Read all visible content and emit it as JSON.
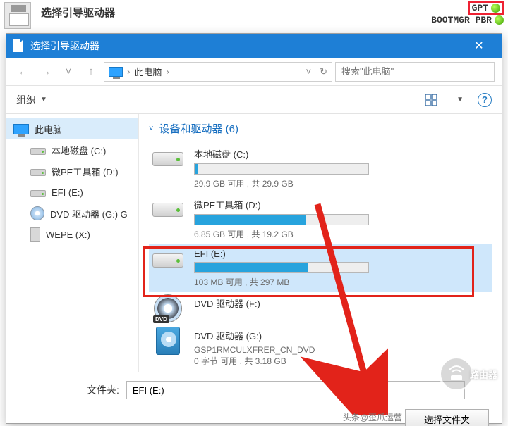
{
  "top": {
    "title": "选择引导驱动器",
    "flags": {
      "gpt": "GPT",
      "bootmgr": "BOOTMGR PBR"
    }
  },
  "dialog": {
    "title": "选择引导驱动器",
    "close_glyph": "✕"
  },
  "nav": {
    "back_glyph": "←",
    "fwd_glyph": "→",
    "up_glyph": "↑",
    "crumb_sep1": "›",
    "crumb_text": "此电脑",
    "crumb_sep2": "›",
    "refresh_glyph": "↻",
    "dd_glyph": "˅",
    "search_placeholder": "搜索\"此电脑\""
  },
  "toolbar": {
    "organize": "组织",
    "dd_glyph": "▼",
    "help_glyph": "?"
  },
  "sidebar": {
    "items": [
      {
        "label": "此电脑"
      },
      {
        "label": "本地磁盘 (C:)"
      },
      {
        "label": "微PE工具箱 (D:)"
      },
      {
        "label": "EFI (E:)"
      },
      {
        "label": "DVD 驱动器 (G:) G"
      },
      {
        "label": "WEPE (X:)"
      }
    ]
  },
  "section": {
    "title": "设备和驱动器 (6)",
    "chev": "˅"
  },
  "drives": [
    {
      "name": "本地磁盘 (C:)",
      "cap": "29.9 GB 可用 , 共 29.9 GB",
      "fill_pct": 2
    },
    {
      "name": "微PE工具箱 (D:)",
      "cap": "6.85 GB 可用 , 共 19.2 GB",
      "fill_pct": 64
    },
    {
      "name": "EFI (E:)",
      "cap": "103 MB 可用 , 共 297 MB",
      "fill_pct": 65
    },
    {
      "name": "DVD 驱动器 (F:)",
      "cap": "",
      "fill_pct": null
    },
    {
      "name": "DVD 驱动器 (G:)",
      "sub": "GSP1RMCULXFRER_CN_DVD",
      "cap": "0 字节 可用 , 共 3.18 GB",
      "fill_pct": null
    }
  ],
  "bottom": {
    "folder_label": "文件夹:",
    "folder_value": "EFI (E:)",
    "select_btn": "选择文件夹"
  },
  "watermark": {
    "text": "路由器"
  },
  "attribution": "头条@歪瓜运营"
}
